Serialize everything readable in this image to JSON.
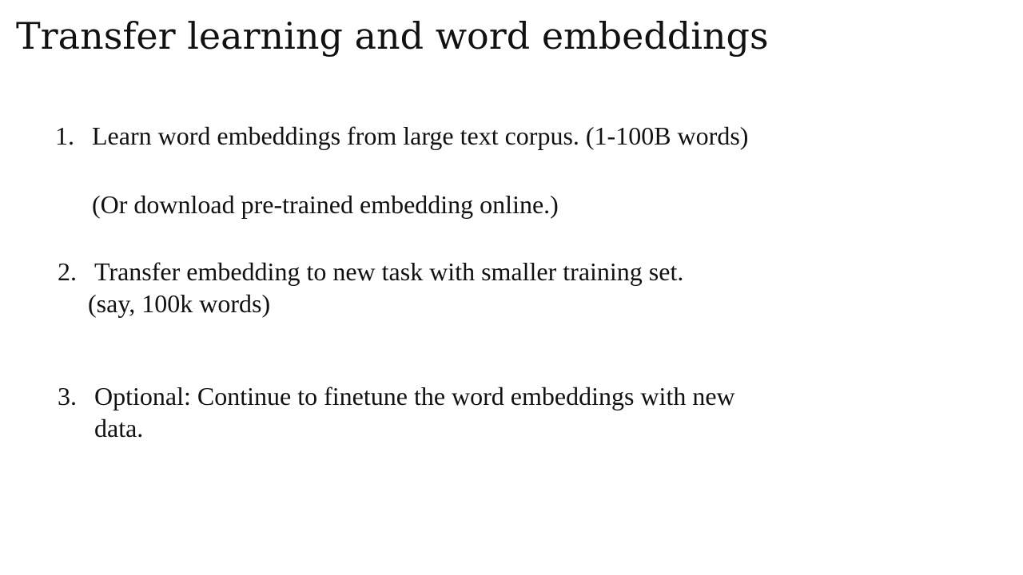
{
  "slide": {
    "title": "Transfer learning and word embeddings",
    "items": [
      {
        "number": "1.",
        "text": "Learn word embeddings from large text corpus. (1-100B words)",
        "continuation": "(Or download pre-trained embedding online.)"
      },
      {
        "number": "2.",
        "text": "Transfer embedding to new task with smaller training set.",
        "continuation": "(say, 100k words)"
      },
      {
        "number": "3.",
        "text": "Optional: Continue to finetune the word embeddings with new",
        "continuation": "data."
      }
    ]
  }
}
